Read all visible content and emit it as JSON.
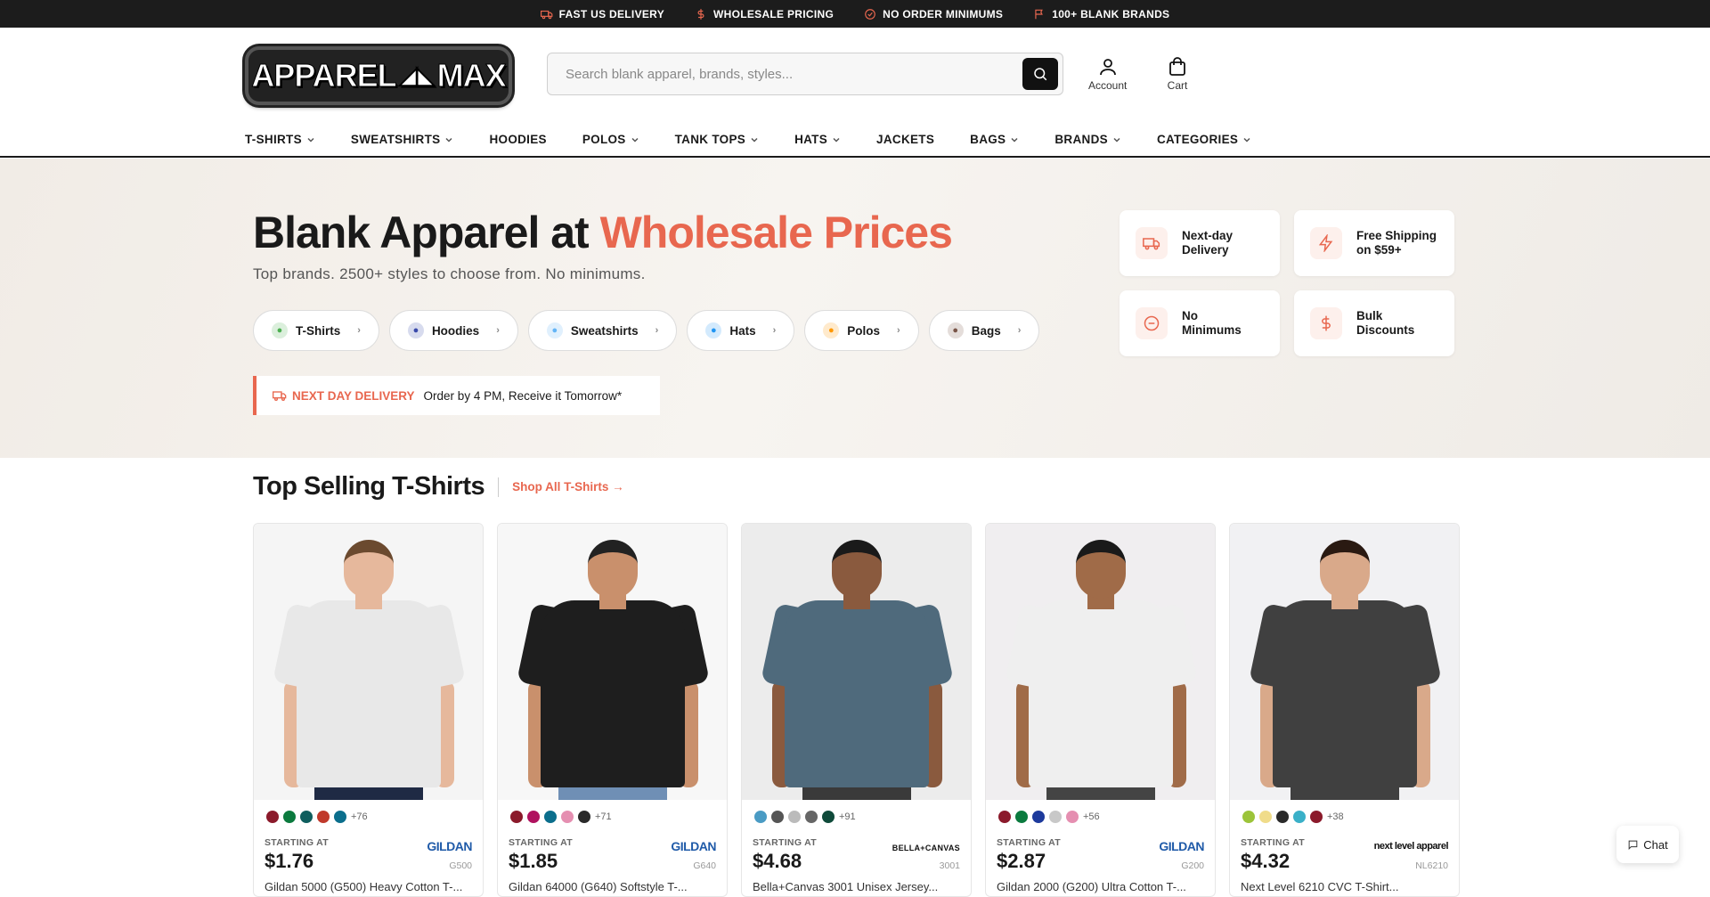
{
  "topbar": [
    {
      "icon": "truck-icon",
      "label": "FAST US DELIVERY"
    },
    {
      "icon": "dollar-icon",
      "label": "WHOLESALE PRICING"
    },
    {
      "icon": "check-circle-icon",
      "label": "NO ORDER MINIMUMS"
    },
    {
      "icon": "flag-icon",
      "label": "100+ BLANK BRANDS"
    }
  ],
  "logo": {
    "left": "APPAREL",
    "right": "MAX"
  },
  "search": {
    "placeholder": "Search blank apparel, brands, styles..."
  },
  "header_icons": {
    "account": "Account",
    "cart": "Cart"
  },
  "nav": [
    {
      "label": "T-SHIRTS",
      "has_dropdown": true
    },
    {
      "label": "SWEATSHIRTS",
      "has_dropdown": true
    },
    {
      "label": "HOODIES",
      "has_dropdown": false
    },
    {
      "label": "POLOS",
      "has_dropdown": true
    },
    {
      "label": "TANK TOPS",
      "has_dropdown": true
    },
    {
      "label": "HATS",
      "has_dropdown": true
    },
    {
      "label": "JACKETS",
      "has_dropdown": false
    },
    {
      "label": "BAGS",
      "has_dropdown": true
    },
    {
      "label": "BRANDS",
      "has_dropdown": true
    },
    {
      "label": "CATEGORIES",
      "has_dropdown": true
    }
  ],
  "hero": {
    "title_main": "Blank Apparel at ",
    "title_accent": "Wholesale Prices",
    "subtitle": "Top brands. 2500+ styles to choose from. No minimums.",
    "chips": [
      {
        "label": "T-Shirts",
        "icon": "tshirt-icon",
        "color": "#4caf50"
      },
      {
        "label": "Hoodies",
        "icon": "hoodie-icon",
        "color": "#3949ab"
      },
      {
        "label": "Sweatshirts",
        "icon": "sweatshirt-icon",
        "color": "#64b5f6"
      },
      {
        "label": "Hats",
        "icon": "hat-icon",
        "color": "#2196f3"
      },
      {
        "label": "Polos",
        "icon": "polo-icon",
        "color": "#ff9800"
      },
      {
        "label": "Bags",
        "icon": "bag-icon",
        "color": "#795548"
      }
    ],
    "delivery_label": "NEXT DAY DELIVERY",
    "delivery_text": "Order by 4 PM, Receive it Tomorrow*",
    "features": [
      {
        "line1": "Next-day",
        "line2": "Delivery",
        "icon": "truck-icon"
      },
      {
        "line1": "Free Shipping",
        "line2": "on $59+",
        "icon": "lightning-icon"
      },
      {
        "line1": "No",
        "line2": "Minimums",
        "icon": "minus-circle-icon"
      },
      {
        "line1": "Bulk",
        "line2": "Discounts",
        "icon": "dollar-icon"
      }
    ]
  },
  "section": {
    "title": "Top Selling T-Shirts",
    "link": "Shop All T-Shirts →"
  },
  "products": [
    {
      "starting": "STARTING AT",
      "price": "$1.76",
      "brand": "GILDAN",
      "sku": "G500",
      "name": "Gildan 5000 (G500) Heavy Cotton T-...",
      "more": "+76",
      "swatches": [
        "#8b1a2b",
        "#0b7a3e",
        "#0f5e5e",
        "#c0392b",
        "#0b6e8c"
      ],
      "shirt": "#e8e8e8",
      "skin": "#e6b89c",
      "hair": "#6b4a2f",
      "pants": "#1f2a44",
      "bg": "#f5f5f5"
    },
    {
      "starting": "STARTING AT",
      "price": "$1.85",
      "brand": "GILDAN",
      "sku": "G640",
      "name": "Gildan 64000 (G640) Softstyle T-...",
      "more": "+71",
      "swatches": [
        "#8b1a2b",
        "#b0125f",
        "#0b6e8c",
        "#e58fb1",
        "#2a2a2a"
      ],
      "shirt": "#1e1e1e",
      "skin": "#c9906c",
      "hair": "#222",
      "pants": "#6f8fb5",
      "bg": "#f7f7f7"
    },
    {
      "starting": "STARTING AT",
      "price": "$4.68",
      "brand": "BELLA+CANVAS",
      "sku": "3001",
      "name": "Bella+Canvas 3001 Unisex Jersey...",
      "more": "+91",
      "swatches": [
        "#4a9bc4",
        "#555",
        "#bbb",
        "#666",
        "#0f4a3a"
      ],
      "shirt": "#4f6a7c",
      "skin": "#8a5a3e",
      "hair": "#1a1a1a",
      "pants": "#3a3a3a",
      "bg": "#ececec"
    },
    {
      "starting": "STARTING AT",
      "price": "$2.87",
      "brand": "GILDAN",
      "sku": "G200",
      "name": "Gildan 2000 (G200) Ultra Cotton T-...",
      "more": "+56",
      "swatches": [
        "#8b1a2b",
        "#0b7a3e",
        "#1d3a9c",
        "#c8c8c8",
        "#e58fb1"
      ],
      "shirt": "#efefef",
      "skin": "#a06b48",
      "hair": "#1a1a1a",
      "pants": "#444",
      "bg": "#f0eef0"
    },
    {
      "starting": "STARTING AT",
      "price": "$4.32",
      "brand": "next level apparel",
      "sku": "NL6210",
      "name": "Next Level 6210 CVC T-Shirt...",
      "more": "+38",
      "swatches": [
        "#9cc43a",
        "#f0dc8a",
        "#2a2a2a",
        "#3ab0c8",
        "#8b1a2b"
      ],
      "shirt": "#404040",
      "skin": "#d9a98a",
      "hair": "#2a1a12",
      "pants": "#404040",
      "bg": "#f1f1f3"
    }
  ],
  "chat": {
    "label": "Chat"
  }
}
